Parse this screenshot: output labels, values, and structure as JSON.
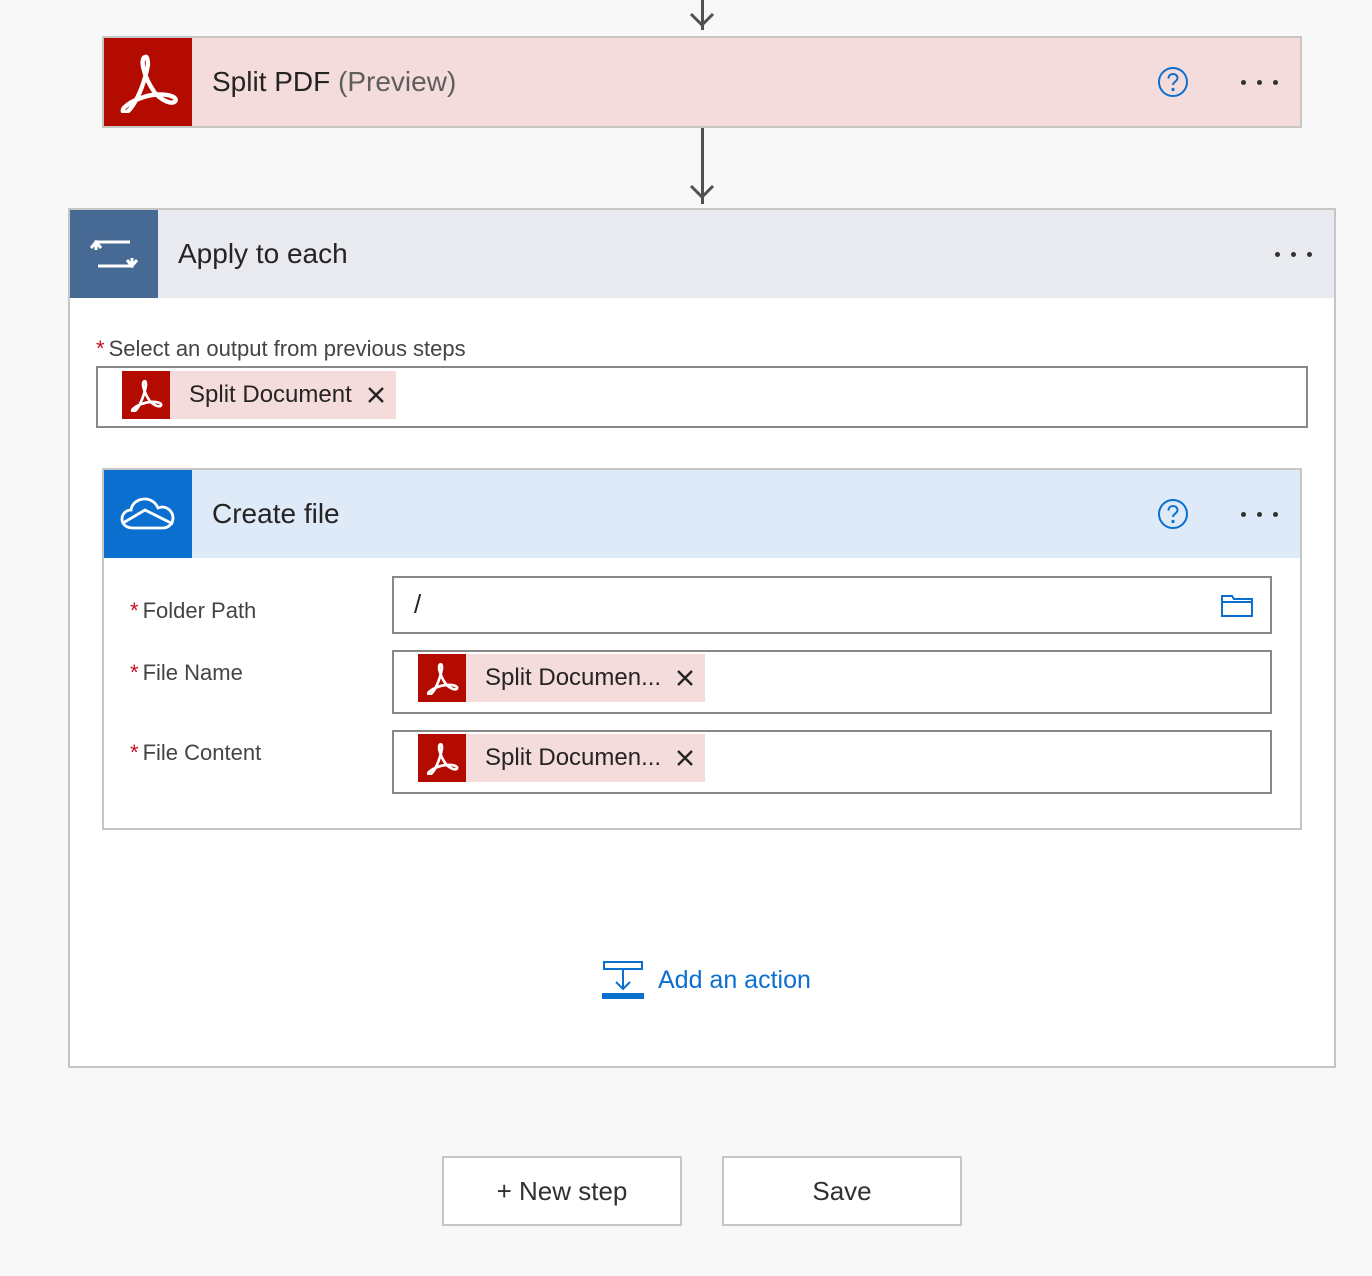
{
  "split_pdf_card": {
    "title": "Split PDF",
    "subtitle": "(Preview)",
    "icon": "adobe-pdf-icon",
    "color": "#b30b00"
  },
  "apply_each_card": {
    "title": "Apply to each",
    "icon": "loop-icon",
    "color": "#476a94",
    "select_label": "Select an output from previous steps",
    "select_token": "Split Document"
  },
  "create_file_card": {
    "title": "Create file",
    "icon": "onedrive-cloud-icon",
    "color": "#0b6fd0",
    "fields": [
      {
        "label": "Folder Path",
        "value": "/"
      },
      {
        "label": "File Name",
        "token": "Split Documen..."
      },
      {
        "label": "File Content",
        "token": "Split Documen..."
      }
    ]
  },
  "add_action": {
    "label": "Add an action"
  },
  "footer": {
    "new_step_label": "+ New step",
    "save_label": "Save"
  },
  "required_marker": "*"
}
